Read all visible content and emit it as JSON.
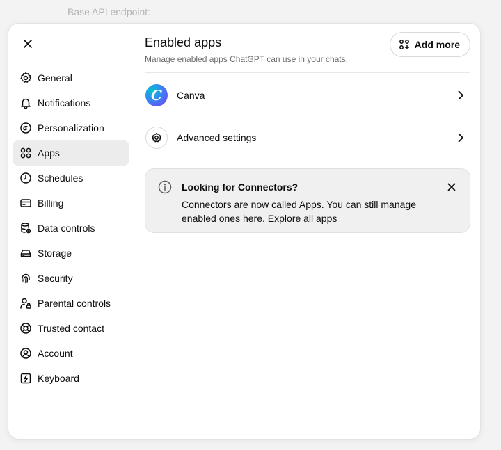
{
  "backdrop": {
    "label": "Base API endpoint:"
  },
  "dialog": {
    "close_icon": "close-icon",
    "sidebar": {
      "items": [
        {
          "label": "General",
          "icon": "gear-icon",
          "active": false
        },
        {
          "label": "Notifications",
          "icon": "bell-icon",
          "active": false
        },
        {
          "label": "Personalization",
          "icon": "personalization-icon",
          "active": false
        },
        {
          "label": "Apps",
          "icon": "apps-grid-icon",
          "active": true
        },
        {
          "label": "Schedules",
          "icon": "clock-icon",
          "active": false
        },
        {
          "label": "Billing",
          "icon": "credit-card-icon",
          "active": false
        },
        {
          "label": "Data controls",
          "icon": "database-icon",
          "active": false
        },
        {
          "label": "Storage",
          "icon": "storage-icon",
          "active": false
        },
        {
          "label": "Security",
          "icon": "fingerprint-icon",
          "active": false
        },
        {
          "label": "Parental controls",
          "icon": "user-lock-icon",
          "active": false
        },
        {
          "label": "Trusted contact",
          "icon": "lifebuoy-icon",
          "active": false
        },
        {
          "label": "Account",
          "icon": "user-circle-icon",
          "active": false
        },
        {
          "label": "Keyboard",
          "icon": "keyboard-icon",
          "active": false
        }
      ]
    },
    "main": {
      "title": "Enabled apps",
      "subtitle": "Manage enabled apps ChatGPT can use in your chats.",
      "add_more_label": "Add more",
      "apps": [
        {
          "label": "Canva",
          "icon": "canva-logo",
          "logo_letter": "C"
        },
        {
          "label": "Advanced settings",
          "icon": "gear-icon"
        }
      ],
      "notice": {
        "title": "Looking for Connectors?",
        "body": "Connectors are now called Apps. You can still manage enabled ones here.",
        "link": "Explore all apps"
      }
    }
  },
  "colors": {
    "active_nav_bg": "#ececec",
    "notice_bg": "#f0f0f0",
    "text_primary": "#0d0d0d",
    "text_secondary": "#6b6b6b"
  }
}
